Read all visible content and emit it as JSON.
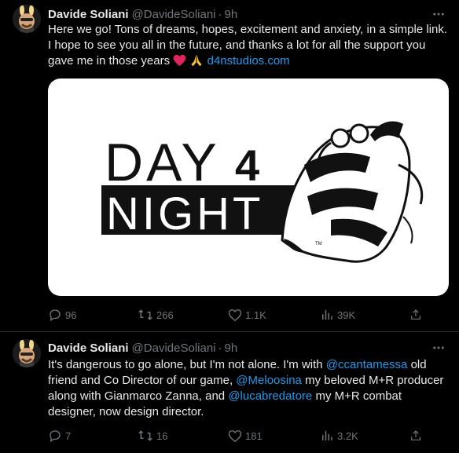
{
  "colors": {
    "background": "#000000",
    "text": "#e7e9ea",
    "muted": "#71767b",
    "link": "#1d9bf0",
    "divider": "#2f3336"
  },
  "tweets": [
    {
      "author_name": "Davide Soliani",
      "author_handle": "@DavideSoliani",
      "separator": "·",
      "time": "9h",
      "text_part1": "Here we go! Tons of dreams, hopes, excitement and anxiety, in a simple link. I hope to see you all in the future, and thanks a lot for all the support you gave me in those years ",
      "link": "d4nstudios.com",
      "card": {
        "logo_line1": "DAY",
        "logo_number": "4",
        "logo_line2": "NIGHT",
        "trademark": "TM"
      },
      "stats": {
        "replies": "96",
        "retweets": "266",
        "likes": "1.1K",
        "views": "39K"
      },
      "icons": [
        "avatar",
        "more-icon",
        "heart-emoji",
        "pray-emoji",
        "reply-icon",
        "retweet-icon",
        "like-icon",
        "views-icon",
        "share-icon"
      ]
    },
    {
      "author_name": "Davide Soliani",
      "author_handle": "@DavideSoliani",
      "separator": "·",
      "time": "9h",
      "text_a": "It's dangerous to go alone, but I'm not alone. I'm with ",
      "mention1": "@ccantamessa",
      "text_b": " old friend and Co Director of our game, ",
      "mention2": "@Meloosina",
      "text_c": " my beloved M+R producer along with Gianmarco Zanna, and ",
      "mention3": "@lucabredatore",
      "text_d": " my M+R combat designer, now design director.",
      "stats": {
        "replies": "7",
        "retweets": "16",
        "likes": "181",
        "views": "3.2K"
      }
    }
  ]
}
